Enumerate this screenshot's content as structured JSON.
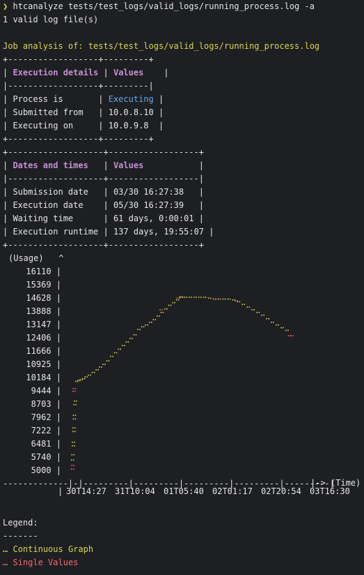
{
  "terminal": {
    "prompt_symbol": "❯",
    "command": "htcanalyze tests/test_logs/valid_logs/running_process.log -a",
    "valid_count_line": "1 valid log file(s)",
    "analysis_heading": "Job analysis of: tests/test_logs/valid_logs/running_process.log"
  },
  "execution_table": {
    "border_top": "+------------------+---------+",
    "header_left": "Execution details",
    "header_right": "Values",
    "rule": "|------------------+---------|",
    "rows": [
      {
        "label": "Process is",
        "value": "Executing",
        "highlight": true
      },
      {
        "label": "Submitted from",
        "value": "10.0.8.10",
        "highlight": false
      },
      {
        "label": "Executing on",
        "value": "10.0.9.8",
        "highlight": false
      }
    ]
  },
  "dates_table": {
    "header_left": "Dates and times",
    "header_right": "Values",
    "rows": [
      {
        "label": "Submission date",
        "value": "03/30 16:27:38"
      },
      {
        "label": "Execution date",
        "value": "05/30 16:27:39"
      },
      {
        "label": "Waiting time",
        "value": "61 days, 0:00:01"
      },
      {
        "label": "Execution runtime",
        "value": "137 days, 19:55:07"
      }
    ]
  },
  "chart_data": {
    "type": "scatter",
    "ylabel": "(Usage)",
    "xlabel": "(Time)",
    "y_ticks": [
      "16110",
      "15369",
      "14628",
      "13888",
      "13147",
      "12406",
      "11666",
      "10925",
      "10184",
      "9444",
      "8703",
      "7962",
      "7222",
      "6481",
      "5740",
      "5000"
    ],
    "ylim": [
      5000,
      16110
    ],
    "x_ticks": [
      "30T14:27",
      "31T10:04",
      "01T05:40",
      "02T01:17",
      "02T20:54",
      "03T16:30"
    ],
    "xlim": [
      0,
      5
    ],
    "series": [
      {
        "name": "Continuous Graph",
        "color": "#d7d94a",
        "points": [
          [
            0.07,
            5600
          ],
          [
            0.08,
            5900
          ],
          [
            0.09,
            6400
          ],
          [
            0.09,
            6600
          ],
          [
            0.1,
            7200
          ],
          [
            0.1,
            7400
          ],
          [
            0.11,
            7900
          ],
          [
            0.11,
            8100
          ],
          [
            0.12,
            8700
          ],
          [
            0.13,
            8900
          ],
          [
            0.16,
            10000
          ],
          [
            0.2,
            10050
          ],
          [
            0.25,
            10100
          ],
          [
            0.3,
            10150
          ],
          [
            0.35,
            10250
          ],
          [
            0.42,
            10350
          ],
          [
            0.5,
            10500
          ],
          [
            0.58,
            10650
          ],
          [
            0.65,
            10800
          ],
          [
            0.72,
            10950
          ],
          [
            0.8,
            11150
          ],
          [
            0.88,
            11400
          ],
          [
            0.96,
            11600
          ],
          [
            1.04,
            11800
          ],
          [
            1.12,
            12000
          ],
          [
            1.2,
            12200
          ],
          [
            1.28,
            12400
          ],
          [
            1.36,
            12600
          ],
          [
            1.44,
            12900
          ],
          [
            1.52,
            13050
          ],
          [
            1.6,
            13150
          ],
          [
            1.68,
            13300
          ],
          [
            1.76,
            13450
          ],
          [
            1.84,
            13650
          ],
          [
            1.92,
            13850
          ],
          [
            2.0,
            14050
          ],
          [
            2.08,
            14250
          ],
          [
            2.16,
            14400
          ],
          [
            2.24,
            14550
          ],
          [
            2.32,
            14700
          ],
          [
            2.4,
            14700
          ],
          [
            2.5,
            14700
          ],
          [
            2.6,
            14700
          ],
          [
            2.7,
            14700
          ],
          [
            2.8,
            14700
          ],
          [
            2.9,
            14650
          ],
          [
            3.0,
            14600
          ],
          [
            3.1,
            14600
          ],
          [
            3.2,
            14600
          ],
          [
            3.3,
            14600
          ],
          [
            3.4,
            14550
          ],
          [
            3.5,
            14450
          ],
          [
            3.6,
            14300
          ],
          [
            3.7,
            14150
          ],
          [
            3.8,
            14000
          ],
          [
            3.9,
            13850
          ],
          [
            4.0,
            13700
          ],
          [
            4.1,
            13500
          ],
          [
            4.2,
            13300
          ],
          [
            4.3,
            13150
          ],
          [
            4.4,
            13000
          ],
          [
            4.5,
            12850
          ]
        ]
      },
      {
        "name": "Single Values",
        "color": "#f26c6c",
        "points": [
          [
            0.07,
            5100
          ],
          [
            0.08,
            5300
          ],
          [
            0.1,
            9450
          ],
          [
            0.11,
            9600
          ],
          [
            1.9,
            14000
          ],
          [
            2.25,
            14650
          ],
          [
            2.3,
            14720
          ],
          [
            3.05,
            14600
          ],
          [
            3.45,
            14500
          ],
          [
            4.55,
            12550
          ],
          [
            4.6,
            12550
          ]
        ]
      }
    ]
  },
  "legend": {
    "title": "Legend:",
    "underline": "-------",
    "continuous_mark": "…",
    "continuous_label": "Continuous Graph",
    "single_mark": "…",
    "single_label": "Single Values",
    "continuous_color": "#d7d94a",
    "single_color": "#f26c6c"
  },
  "axis_text": {
    "y_caret": "^",
    "x_arrow": "|-> (Time)"
  }
}
